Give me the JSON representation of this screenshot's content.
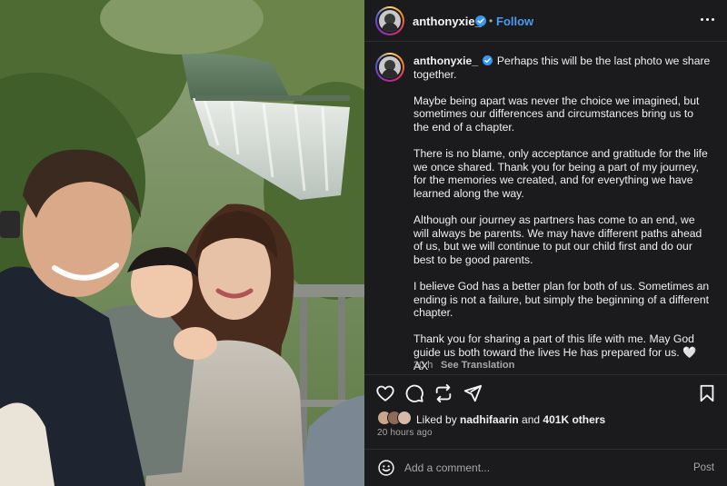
{
  "post": {
    "username": "anthonyxie_",
    "dot": "•",
    "follow_label": "Follow",
    "caption_username": "anthonyxie_",
    "caption": [
      "Perhaps this will be the last photo we share together.",
      "Maybe being apart was never the choice we imagined, but sometimes our differences and circumstances bring us to the end of a chapter.",
      "There is no blame, only acceptance and gratitude for the life we once shared. Thank you for being a part of my journey, for the memories we created, and for everything we have learned along the way.",
      "Although our journey as partners has come to an end, we will always be parents. We may have different paths ahead of us, but we will continue to put our child first and do our best to be good parents.",
      "I believe God has a better plan for both of us. Sometimes an ending is not a failure, but simply the beginning of a different chapter.",
      "Thank you for sharing a part of this life with me. May God guide us both toward the lives He has prepared for us. 🤍 AX"
    ],
    "relative_time": "20 h",
    "see_translation": "See Translation",
    "likes_prefix": "Liked by ",
    "liked_by_user": "nadhifaarin",
    "likes_and": " and ",
    "likes_others": "401K others",
    "timestamp": "20 hours ago"
  },
  "comment": {
    "placeholder": "Add a comment...",
    "post_label": "Post"
  },
  "icons": {
    "verified": "verified-badge-icon",
    "more": "more-options-icon",
    "like": "heart-icon",
    "comment": "comment-icon",
    "repost": "repost-icon",
    "share": "share-icon",
    "save": "bookmark-icon",
    "emoji": "emoji-icon"
  },
  "colors": {
    "panel_bg": "#1b1b1d",
    "link_blue": "#4a9bf5",
    "verified_blue": "#3897f0",
    "muted_text": "#a8a8a8"
  }
}
